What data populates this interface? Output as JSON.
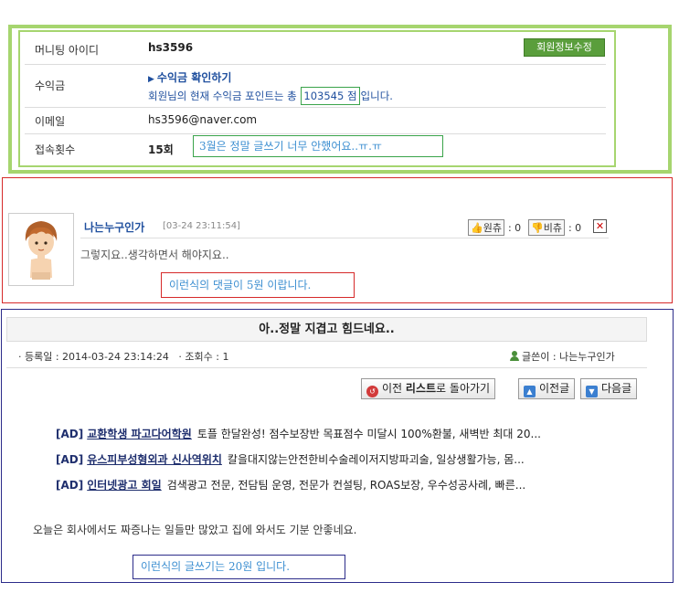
{
  "member": {
    "id_label": "머니팅 아이디",
    "id_value": "hs3596",
    "edit_button": "회원정보수정",
    "revenue_label": "수익금",
    "revenue_link": "수익금 확인하기",
    "revenue_prefix": "회원님의 현재 수익금 포인트는 총",
    "revenue_points": "103545 점",
    "revenue_suffix": "입니다.",
    "email_label": "이메일",
    "email_value": "hs3596@naver.com",
    "visits_label": "접속횟수",
    "visits_value": "15회",
    "note": "3월은 정말 글쓰기 너무 안했어요..ㅠ.ㅠ"
  },
  "comment": {
    "author": "나는누구인가",
    "date": "[03-24 23:11:54]",
    "agree_label": "원츄",
    "agree_count": ": 0",
    "disagree_label": "비츄",
    "disagree_count": ": 0",
    "close_label": "✕",
    "text": "그렇지요..생각하면서 해야지요..",
    "note": "이런식의 댓글이 5원 이랍니다."
  },
  "post": {
    "title": "아..정말 지겹고 힘드네요..",
    "date_label": "· 등록일 : 2014-03-24 23:14:24",
    "views_label": "· 조회수 : 1",
    "author_label": "글쓴이 : 나는누구인가",
    "back_prefix": "이전",
    "back_bold": "리스트",
    "back_suffix": "로 돌아가기",
    "prev_button": "이전글",
    "next_button": "다음글",
    "ads": [
      {
        "tag": "[AD]",
        "title": "교환학생 파고다어학원",
        "desc": "토플 한달완성! 점수보장반 목표점수 미달시 100%환불, 새벽반 최대 20..."
      },
      {
        "tag": "[AD]",
        "title": "유스피부성형외과 신사역위치",
        "desc": "칼을대지않는안전한비수술레이저지방파괴술, 일상생활가능, 몸..."
      },
      {
        "tag": "[AD]",
        "title": "인터넷광고 회일",
        "desc": "검색광고 전문, 전담팀 운영, 전문가 컨설팅, ROAS보장, 우수성공사례, 빠른..."
      }
    ],
    "body": "오늘은 회사에서도 짜증나는 일들만 많았고 집에 와서도 기분 안좋네요.",
    "note": "이런식의 글쓰기는 20원 입니다."
  }
}
